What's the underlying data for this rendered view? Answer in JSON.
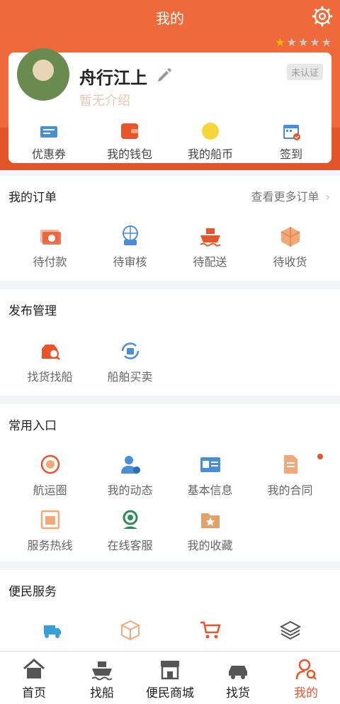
{
  "header": {
    "title": "我的",
    "rating_filled": 1,
    "rating_total": 5
  },
  "profile": {
    "name": "舟行江上",
    "intro": "暂无介绍",
    "verify_badge": "未认证"
  },
  "quick_links": [
    {
      "label": "优惠券",
      "icon": "coupon-icon"
    },
    {
      "label": "我的钱包",
      "icon": "wallet-icon"
    },
    {
      "label": "我的船币",
      "icon": "coin-icon"
    },
    {
      "label": "签到",
      "icon": "calendar-icon"
    }
  ],
  "orders": {
    "title": "我的订单",
    "more": "查看更多订单",
    "items": [
      {
        "label": "待付款",
        "icon": "payment-icon"
      },
      {
        "label": "待审核",
        "icon": "review-icon"
      },
      {
        "label": "待配送",
        "icon": "ship-delivery-icon"
      },
      {
        "label": "待收货",
        "icon": "package-icon"
      }
    ]
  },
  "publish": {
    "title": "发布管理",
    "items": [
      {
        "label": "找货找船",
        "icon": "find-cargo-icon"
      },
      {
        "label": "船舶买卖",
        "icon": "ship-trade-icon"
      }
    ]
  },
  "common": {
    "title": "常用入口",
    "items": [
      {
        "label": "航运圈",
        "icon": "shipping-circle-icon"
      },
      {
        "label": "我的动态",
        "icon": "user-info-icon"
      },
      {
        "label": "基本信息",
        "icon": "id-card-icon"
      },
      {
        "label": "我的合同",
        "icon": "contract-icon",
        "has_dot": true
      },
      {
        "label": "服务热线",
        "icon": "phone-icon"
      },
      {
        "label": "在线客服",
        "icon": "headset-icon"
      },
      {
        "label": "我的收藏",
        "icon": "favorites-folder-icon"
      }
    ]
  },
  "services": {
    "title": "便民服务",
    "items": [
      {
        "icon": "truck-icon"
      },
      {
        "icon": "box-icon"
      },
      {
        "icon": "cart-icon"
      },
      {
        "icon": "layers-icon"
      }
    ]
  },
  "tabbar": [
    {
      "label": "首页",
      "icon": "home-icon"
    },
    {
      "label": "找船",
      "icon": "ship-icon"
    },
    {
      "label": "便民商城",
      "icon": "store-icon"
    },
    {
      "label": "找货",
      "icon": "cargo-truck-icon"
    },
    {
      "label": "我的",
      "icon": "profile-icon",
      "active": true
    }
  ],
  "colors": {
    "primary": "#ef6a3a",
    "accent": "#e8552a",
    "blue": "#4a8fd6"
  }
}
